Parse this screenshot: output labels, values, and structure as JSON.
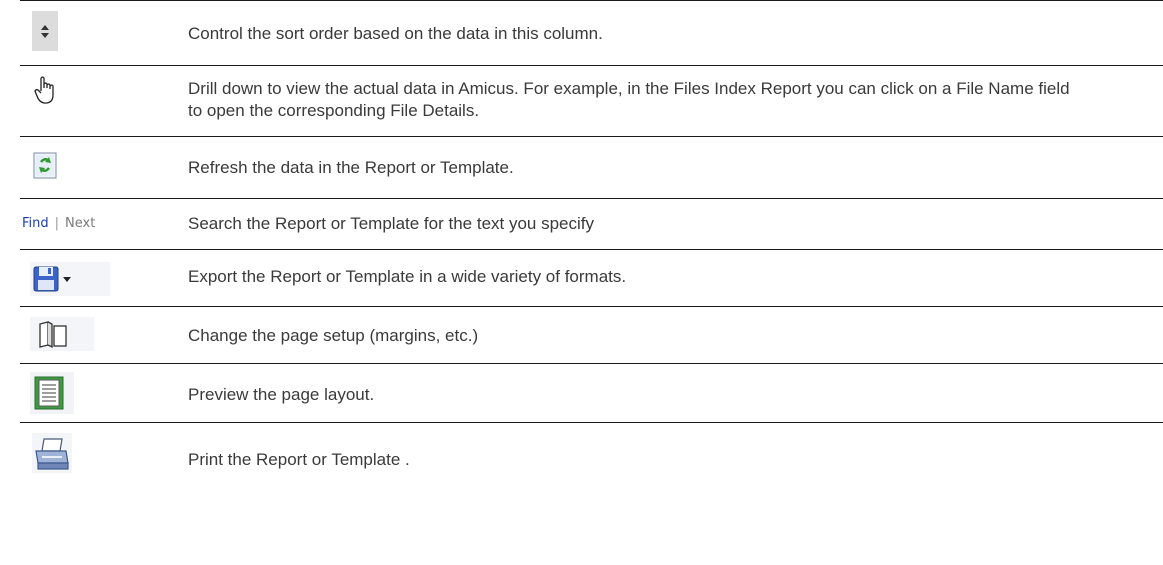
{
  "rows": [
    {
      "icon": "sort-arrows-icon",
      "text": "Control the sort order based on the data in this column."
    },
    {
      "icon": "hand-pointer-icon",
      "text": "Drill down to view the actual data in Amicus. For example, in the Files Index Report you can click on a File Name field to open the corresponding File Details."
    },
    {
      "icon": "refresh-icon",
      "text": "Refresh the data in the Report or Template."
    },
    {
      "icon": "find-next-links",
      "find_label": "Find",
      "separator": "|",
      "next_label": "Next",
      "text": "Search the Report or Template for the text you specify"
    },
    {
      "icon": "save-dropdown-icon",
      "text": "Export the Report or Template in a wide variety of formats."
    },
    {
      "icon": "page-setup-icon",
      "text": "Change the page setup (margins, etc.)"
    },
    {
      "icon": "print-preview-icon",
      "text": "Preview the page layout."
    },
    {
      "icon": "printer-icon",
      "text": "Print the Report or Template ."
    }
  ]
}
